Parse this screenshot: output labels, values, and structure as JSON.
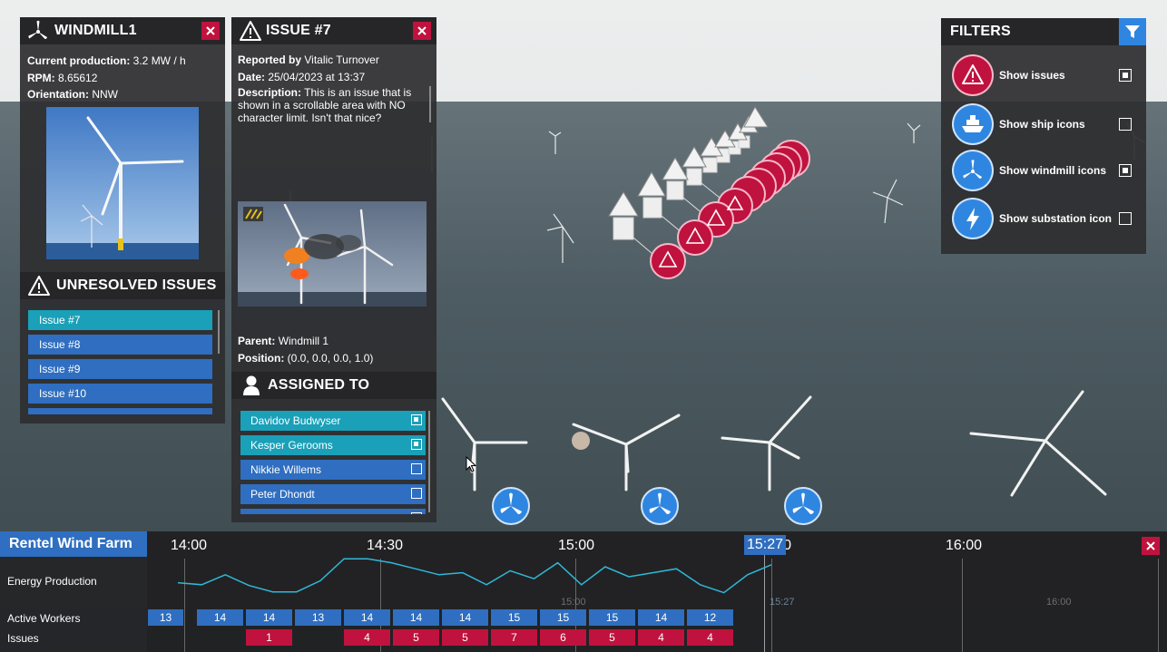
{
  "windmill_panel": {
    "title": "WINDMILL1",
    "production_label": "Current production:",
    "production_value": "3.2 MW / h",
    "rpm_label": "RPM:",
    "rpm_value": "8.65612",
    "orientation_label": "Orientation:",
    "orientation_value": "NNW"
  },
  "unresolved_issues": {
    "title": "UNRESOLVED ISSUES",
    "items": [
      "Issue #7",
      "Issue #8",
      "Issue #9",
      "Issue #10"
    ]
  },
  "issue_panel": {
    "title": "ISSUE #7",
    "reported_label": "Reported by",
    "reported_value": "Vitalic Turnover",
    "date_label": "Date:",
    "date_value": "25/04/2023 at 13:37",
    "description_label": "Description:",
    "description_value": "This is an issue that is shown in a scrollable area with NO character limit. Isn't that nice?",
    "parent_label": "Parent:",
    "parent_value": "Windmill 1",
    "position_label": "Position:",
    "position_value": "(0.0, 0.0, 0.0, 1.0)"
  },
  "assigned": {
    "title": "ASSIGNED TO",
    "people": [
      {
        "name": "Davidov Budwyser",
        "checked": true
      },
      {
        "name": "Kesper Gerooms",
        "checked": true
      },
      {
        "name": "Nikkie Willems",
        "checked": false
      },
      {
        "name": "Peter Dhondt",
        "checked": false
      }
    ]
  },
  "filters": {
    "title": "FILTERS",
    "items": [
      {
        "label": "Show issues",
        "checked": true,
        "icon": "warning-icon",
        "color": "#c0123e"
      },
      {
        "label": "Show ship icons",
        "checked": false,
        "icon": "ship-icon",
        "color": "#2f86e0"
      },
      {
        "label": "Show windmill icons",
        "checked": true,
        "icon": "windmill-icon",
        "color": "#2f86e0"
      },
      {
        "label": "Show substation icon",
        "checked": false,
        "icon": "lightning-icon",
        "color": "#2f86e0"
      }
    ]
  },
  "timeline": {
    "farm_name": "Rentel Wind Farm",
    "ticks": [
      "14:00",
      "14:30",
      "15:00",
      "15:30",
      "16:00"
    ],
    "current_time": "15:27",
    "mini_ticks": [
      "15:00",
      "15:27",
      "16:00"
    ],
    "rows": {
      "energy": "Energy Production",
      "workers": "Active Workers",
      "issues": "Issues"
    },
    "workers_values": [
      "13",
      "14",
      "14",
      "13",
      "14",
      "14",
      "14",
      "15",
      "15",
      "15",
      "14",
      "12"
    ],
    "issues_values": [
      "",
      "",
      "1",
      "",
      "4",
      "5",
      "5",
      "7",
      "6",
      "5",
      "4",
      "4"
    ],
    "energy_series": [
      0.35,
      0.3,
      0.55,
      0.28,
      0.12,
      0.12,
      0.4,
      0.95,
      0.95,
      0.85,
      0.7,
      0.55,
      0.6,
      0.3,
      0.65,
      0.45,
      0.85,
      0.3,
      0.75,
      0.5,
      0.6,
      0.7,
      0.3,
      0.1,
      0.55,
      0.8
    ]
  },
  "colors": {
    "accent_red": "#c0123e",
    "accent_blue": "#2f6ec0",
    "accent_teal": "#1aa0b8",
    "filter_blue": "#2f86e0"
  }
}
